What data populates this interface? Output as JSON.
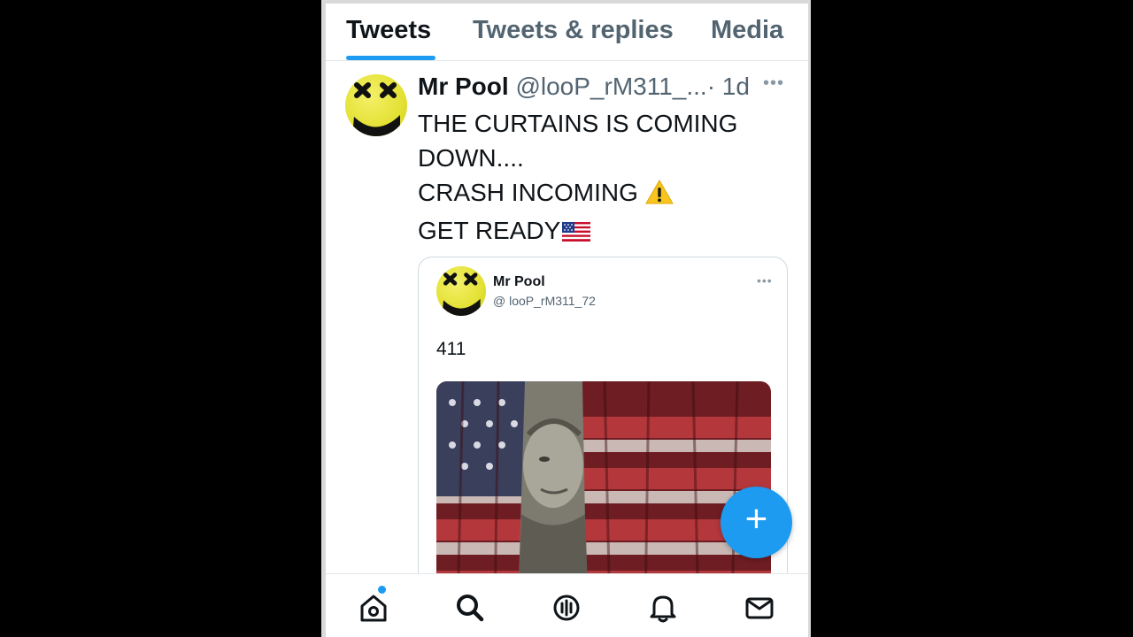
{
  "tabs": [
    {
      "label": "Tweets",
      "active": true
    },
    {
      "label": "Tweets & replies",
      "active": false
    },
    {
      "label": "Media",
      "active": false
    }
  ],
  "tweet": {
    "display_name": "Mr Pool",
    "handle": "@looP_rM311_...",
    "timestamp": "· 1d",
    "more_icon": "more-horizontal-icon",
    "lines": [
      "THE CURTAINS IS COMING",
      "DOWN....",
      "CRASH INCOMING",
      "GET READY"
    ],
    "emoji": [
      "warning-emoji",
      "us-flag-emoji"
    ]
  },
  "quoted_tweet": {
    "display_name": "Mr Pool",
    "handle": "@ looP_rM311_72",
    "text": "411",
    "image": "benjamin-franklin-behind-american-flag-curtain"
  },
  "fab_label": "+",
  "bottom_nav": [
    {
      "icon": "home-icon",
      "has_badge": true
    },
    {
      "icon": "search-icon"
    },
    {
      "icon": "spaces-icon"
    },
    {
      "icon": "bell-icon"
    },
    {
      "icon": "mail-icon"
    }
  ],
  "colors": {
    "accent": "#1d9bf0",
    "text_primary": "#0f1419",
    "text_secondary": "#536471",
    "avatar_yellow": "#e3e133"
  }
}
